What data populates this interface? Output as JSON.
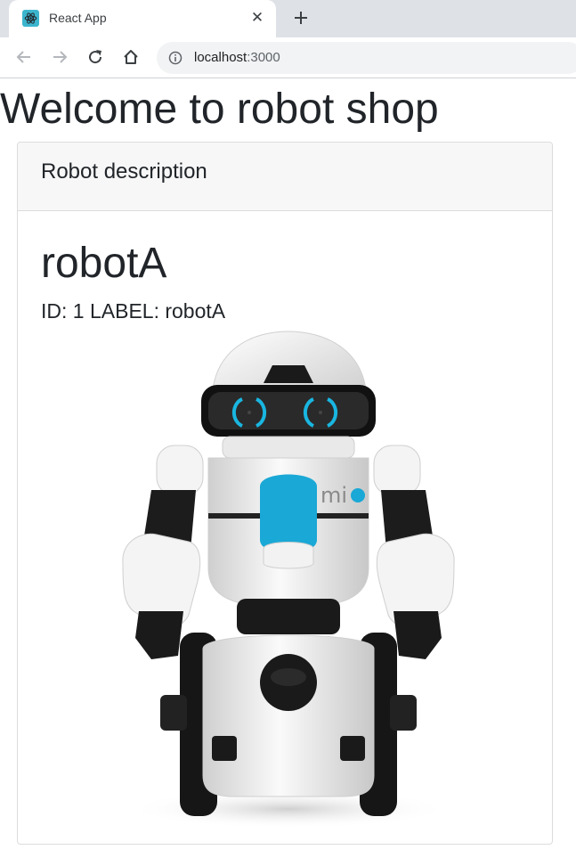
{
  "browser": {
    "tab": {
      "title": "React App",
      "favicon": "react-atom-icon",
      "close_glyph": "✕"
    },
    "new_tab_glyph": "+",
    "url": {
      "host": "localhost",
      "port": ":3000"
    },
    "nav": [
      "back-icon",
      "forward-icon",
      "reload-icon",
      "home-icon"
    ],
    "colors": {
      "tabstrip": "#dee1e6",
      "omnibox": "#f1f3f4",
      "favicon": "#3bb5cd"
    }
  },
  "page": {
    "heading": "Welcome to robot shop",
    "card": {
      "header": "Robot description",
      "robot": {
        "name": "robotA",
        "id_label": "ID:",
        "id": "1",
        "label_label": "LABEL:",
        "label": "robotA",
        "image": "white-robot-photo"
      }
    }
  }
}
